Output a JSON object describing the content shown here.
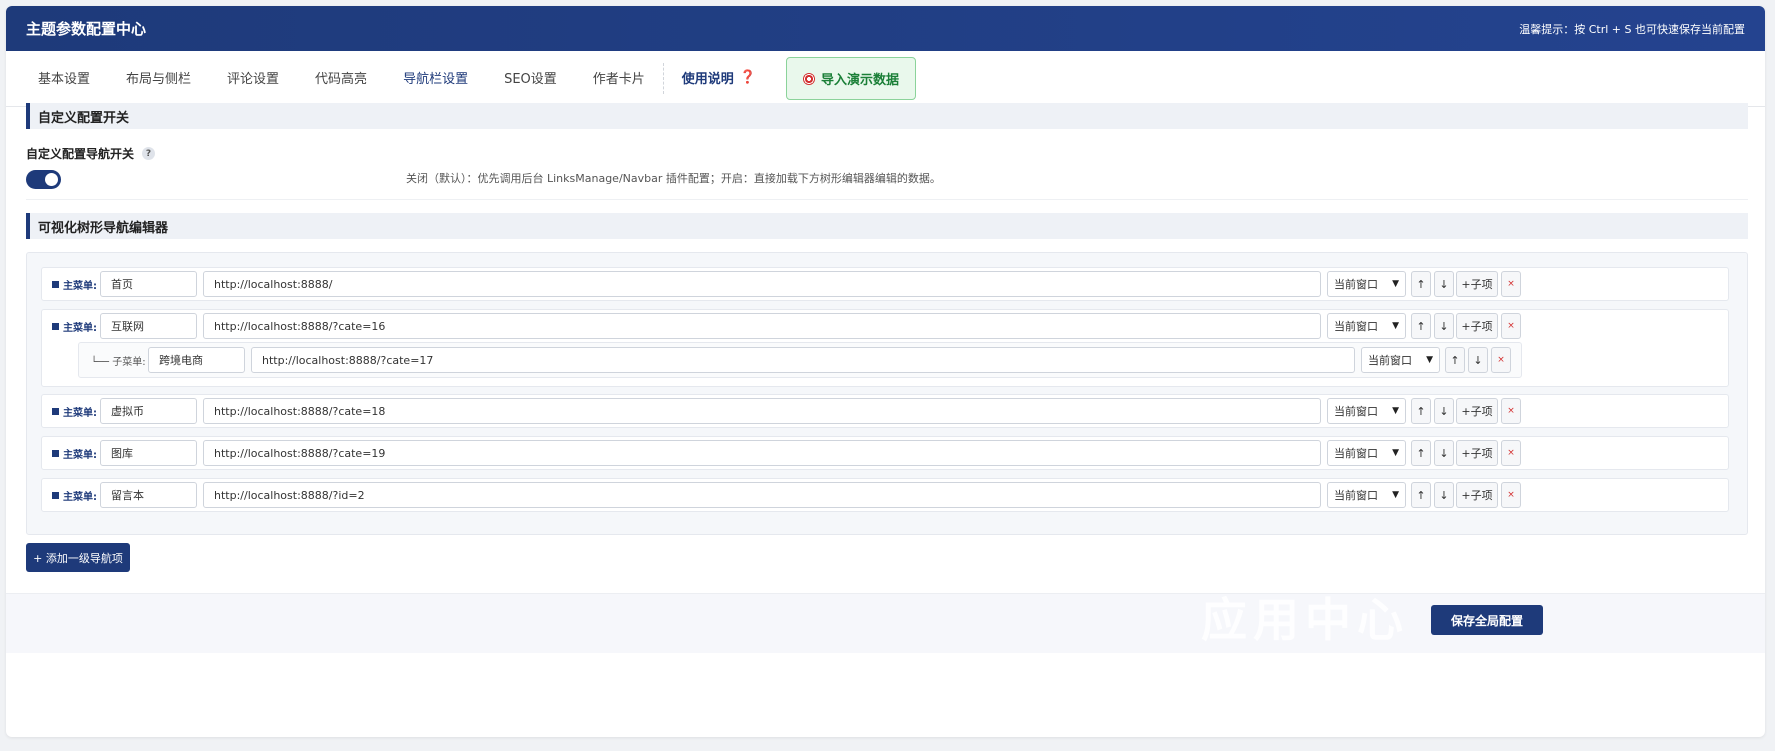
{
  "header": {
    "title": "主题参数配置中心",
    "hint": "温馨提示：按 Ctrl + S 也可快速保存当前配置"
  },
  "tabs": [
    {
      "label": "基本设置",
      "active": false
    },
    {
      "label": "布局与侧栏",
      "active": false
    },
    {
      "label": "评论设置",
      "active": false
    },
    {
      "label": "代码高亮",
      "active": false
    },
    {
      "label": "导航栏设置",
      "active": true
    },
    {
      "label": "SEO设置",
      "active": false
    },
    {
      "label": "作者卡片",
      "active": false
    }
  ],
  "help_tab": {
    "label": "使用说明",
    "mark": "❓"
  },
  "import_button": {
    "label": "导入演示数据",
    "icon": "target-icon"
  },
  "section_custom": {
    "title": "自定义配置开关"
  },
  "nav_switch": {
    "label": "自定义配置导航开关",
    "help": "?",
    "enabled": true,
    "description": "关闭（默认）：优先调用后台 LinksManage/Navbar 插件配置；开启：直接加载下方树形编辑器编辑的数据。"
  },
  "section_editor": {
    "title": "可视化树形导航编辑器"
  },
  "editor": {
    "main_label": "主菜单:",
    "sub_prefix": "└──",
    "sub_label": "子菜单:",
    "add_child_label": "+子项",
    "up_label": "↑",
    "down_label": "↓",
    "delete_label": "×",
    "items": [
      {
        "name": "首页",
        "url": "http://localhost:8888/",
        "target": "当前窗口"
      },
      {
        "name": "互联网",
        "url": "http://localhost:8888/?cate=16",
        "target": "当前窗口",
        "children": [
          {
            "name": "跨境电商",
            "url": "http://localhost:8888/?cate=17",
            "target": "当前窗口"
          }
        ]
      },
      {
        "name": "虚拟币",
        "url": "http://localhost:8888/?cate=18",
        "target": "当前窗口"
      },
      {
        "name": "图库",
        "url": "http://localhost:8888/?cate=19",
        "target": "当前窗口"
      },
      {
        "name": "留言本",
        "url": "http://localhost:8888/?id=2",
        "target": "当前窗口"
      }
    ]
  },
  "add_top_button": {
    "label": "+ 添加一级导航项"
  },
  "save_button": {
    "label": "保存全局配置"
  },
  "watermark": {
    "text": "应用中心"
  }
}
